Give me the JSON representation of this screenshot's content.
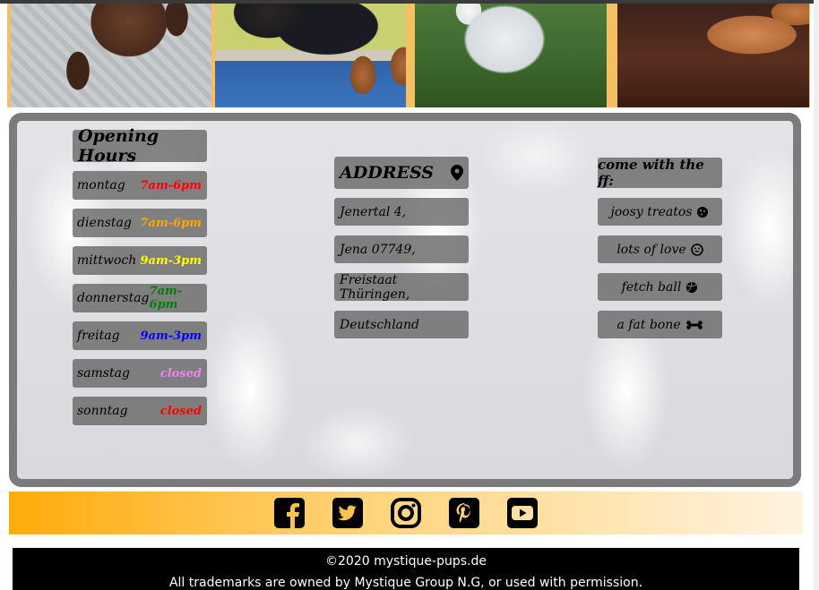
{
  "hours": {
    "title": "Opening Hours",
    "rows": [
      {
        "day": "montag",
        "time": "7am-6pm",
        "color": "#ff0000"
      },
      {
        "day": "dienstag",
        "time": "7am-6pm",
        "color": "#ffa500"
      },
      {
        "day": "mittwoch",
        "time": "9am-3pm",
        "color": "#ffff00"
      },
      {
        "day": "donnerstag",
        "time": "7am-6pm",
        "color": "#008000"
      },
      {
        "day": "freitag",
        "time": "9am-3pm",
        "color": "#0000ff"
      },
      {
        "day": "samstag",
        "time": "closed",
        "color": "#ee82ee"
      },
      {
        "day": "sonntag",
        "time": "closed",
        "color": "#ff0000"
      }
    ]
  },
  "address": {
    "title": "ADDRESS",
    "icon": "map-pin-icon",
    "lines": [
      "Jenertal 4,",
      "Jena 07749,",
      "Freistaat Thüringen,",
      "Deutschland"
    ]
  },
  "bring": {
    "title": "come with the ff:",
    "items": [
      {
        "label": "joosy treatos",
        "icon": "cookie-icon"
      },
      {
        "label": "lots of love",
        "icon": "smile-icon"
      },
      {
        "label": "fetch ball",
        "icon": "ball-icon"
      },
      {
        "label": "a fat bone",
        "icon": "bone-icon"
      }
    ]
  },
  "social": {
    "icons": [
      "facebook-icon",
      "twitter-icon",
      "instagram-icon",
      "pinterest-icon",
      "youtube-icon"
    ]
  },
  "footer": {
    "copyright": "©2020 mystique-pups.de",
    "trademark": "All trademarks are owned by Mystique Group N.G, or used with permission."
  },
  "colors": {
    "panel_border": "#7b7b7b",
    "social_gradient_start": "#ffab0a",
    "footer_bg": "#000000"
  }
}
